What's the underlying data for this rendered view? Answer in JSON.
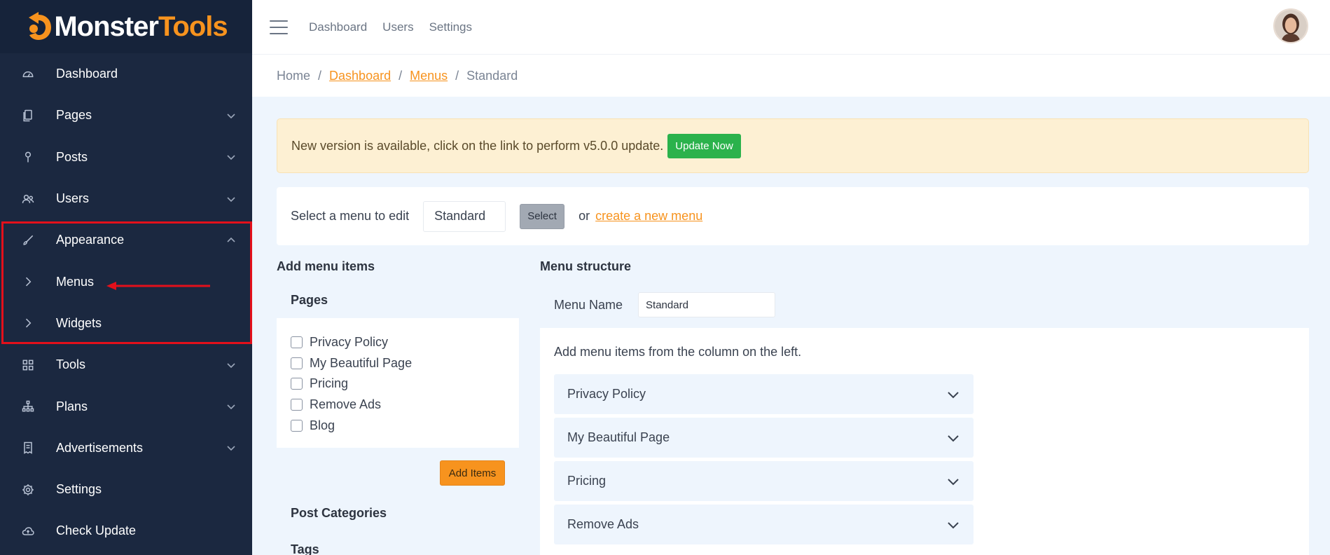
{
  "app": {
    "logo_part1": "Monster",
    "logo_part2": "Tools",
    "brand_color": "#f7931e"
  },
  "sidebar": {
    "items": [
      {
        "label": "Dashboard",
        "icon": "gauge-icon",
        "has_chevron": false
      },
      {
        "label": "Pages",
        "icon": "file-icon",
        "has_chevron": true
      },
      {
        "label": "Posts",
        "icon": "pin-icon",
        "has_chevron": true
      },
      {
        "label": "Users",
        "icon": "users-icon",
        "has_chevron": true
      },
      {
        "label": "Appearance",
        "icon": "brush-icon",
        "has_chevron": true,
        "expanded": true
      },
      {
        "label": "Menus",
        "icon": "chevron-right-icon",
        "sub": true
      },
      {
        "label": "Widgets",
        "icon": "chevron-right-icon",
        "sub": true
      },
      {
        "label": "Tools",
        "icon": "grid-icon",
        "has_chevron": true
      },
      {
        "label": "Plans",
        "icon": "sitemap-icon",
        "has_chevron": true
      },
      {
        "label": "Advertisements",
        "icon": "receipt-icon",
        "has_chevron": true
      },
      {
        "label": "Settings",
        "icon": "gear-icon",
        "has_chevron": false
      },
      {
        "label": "Check Update",
        "icon": "cloud-icon",
        "has_chevron": false
      }
    ]
  },
  "topbar": {
    "links": [
      "Dashboard",
      "Users",
      "Settings"
    ]
  },
  "breadcrumb": {
    "home": "Home",
    "dashboard": "Dashboard",
    "menus": "Menus",
    "current": "Standard",
    "separator": "/"
  },
  "alert": {
    "message": "New version is available, click on the link to perform v5.0.0 update.",
    "button": "Update Now"
  },
  "select_menu": {
    "label": "Select a menu to edit",
    "value": "Standard",
    "button": "Select",
    "or_text": "or",
    "create_link": "create a new menu"
  },
  "add_items": {
    "heading": "Add menu items",
    "pages_heading": "Pages",
    "pages": [
      "Privacy Policy",
      "My Beautiful Page",
      "Pricing",
      "Remove Ads",
      "Blog"
    ],
    "add_button": "Add Items",
    "post_categories": "Post Categories",
    "tags": "Tags"
  },
  "structure": {
    "heading": "Menu structure",
    "name_label": "Menu Name",
    "name_value": "Standard",
    "hint": "Add menu items from the column on the left.",
    "items": [
      "Privacy Policy",
      "My Beautiful Page",
      "Pricing",
      "Remove Ads"
    ]
  }
}
